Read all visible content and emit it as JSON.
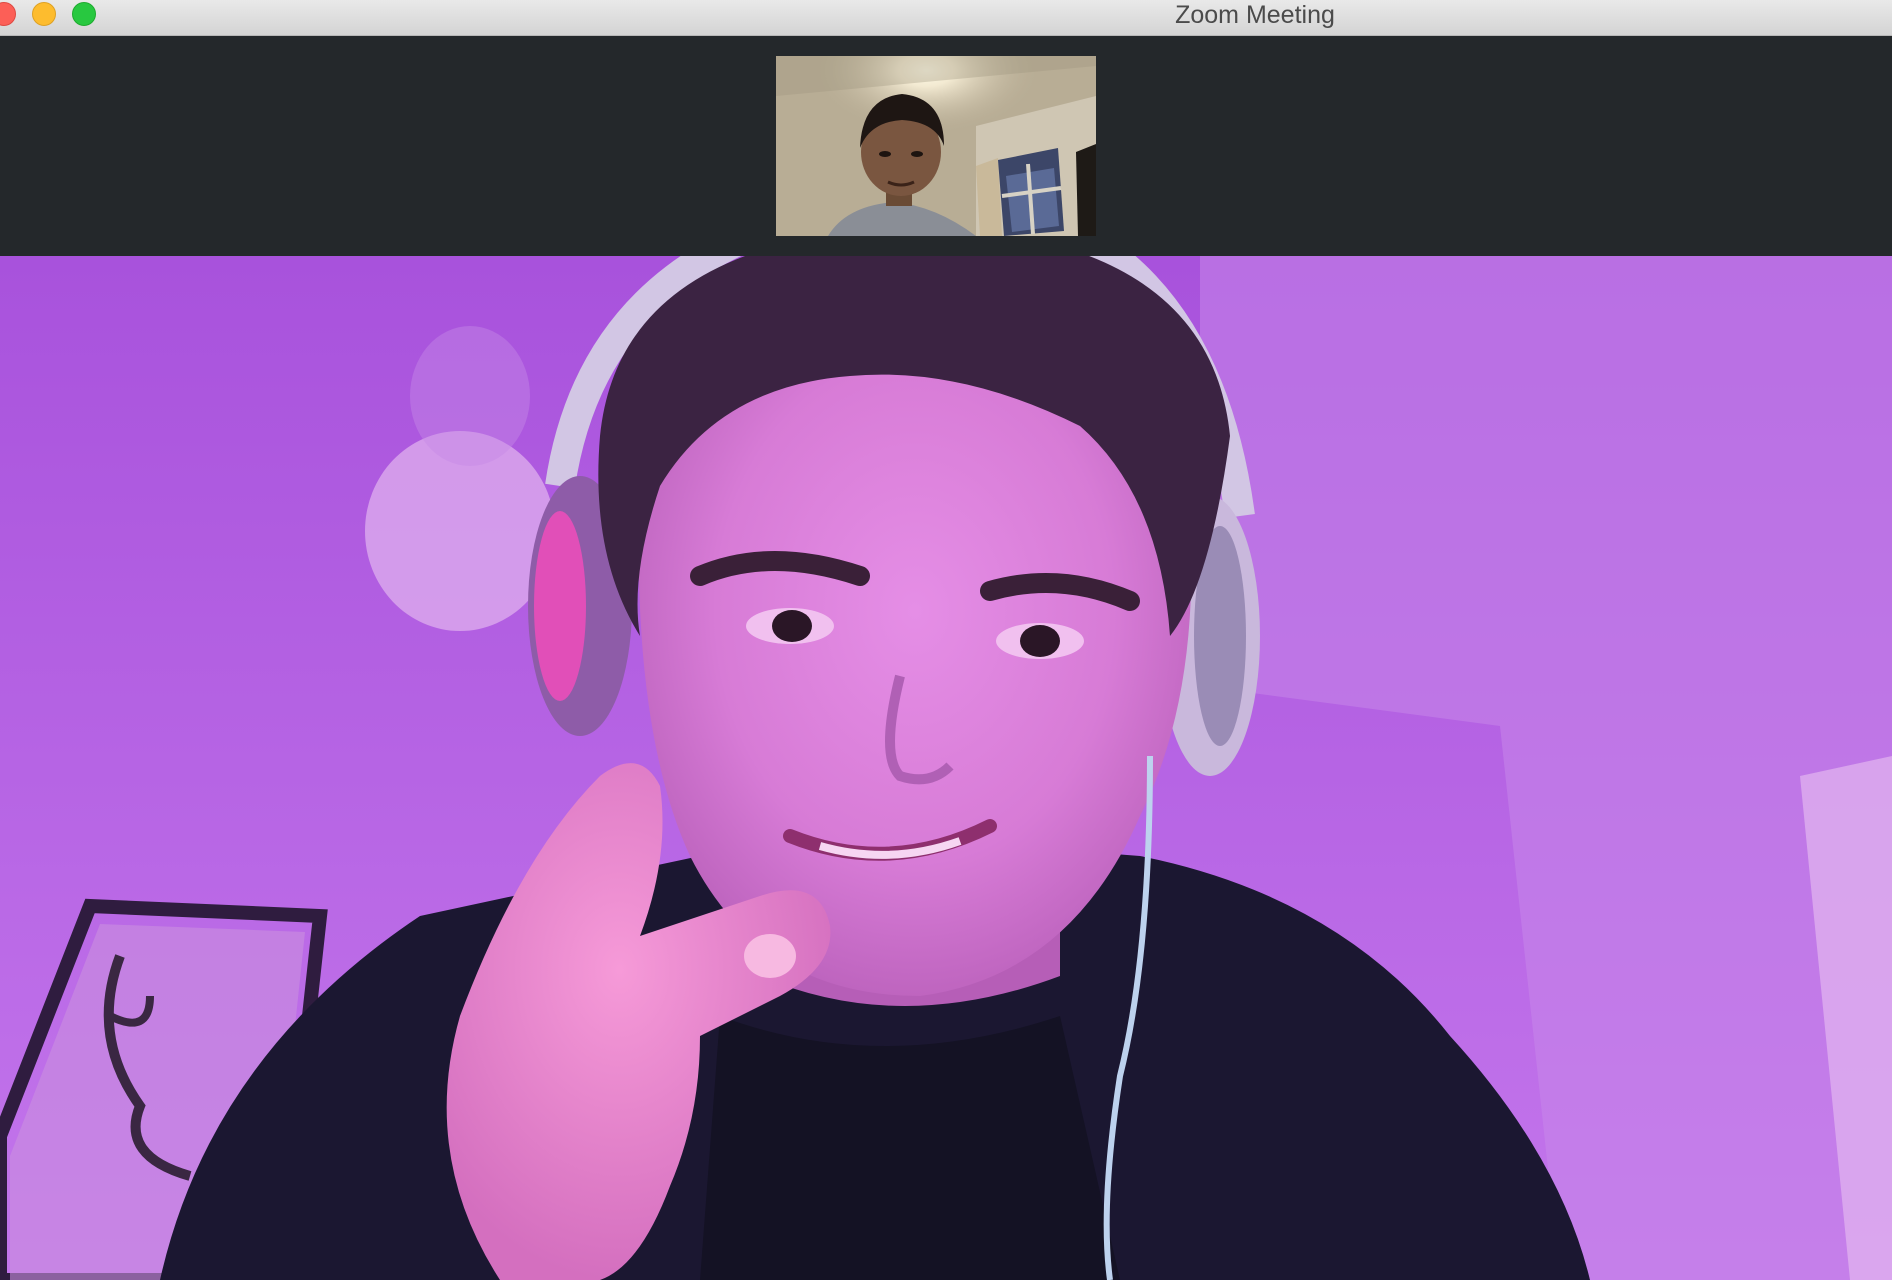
{
  "window": {
    "title": "Zoom Meeting"
  },
  "controls": {
    "close_color": "#fc5f57",
    "minimize_color": "#fdbc2e",
    "maximize_color": "#28c840"
  },
  "gallery": {
    "thumbnail_icon": "self-view-thumbnail"
  },
  "main": {
    "background_color": "#b65ee4"
  }
}
